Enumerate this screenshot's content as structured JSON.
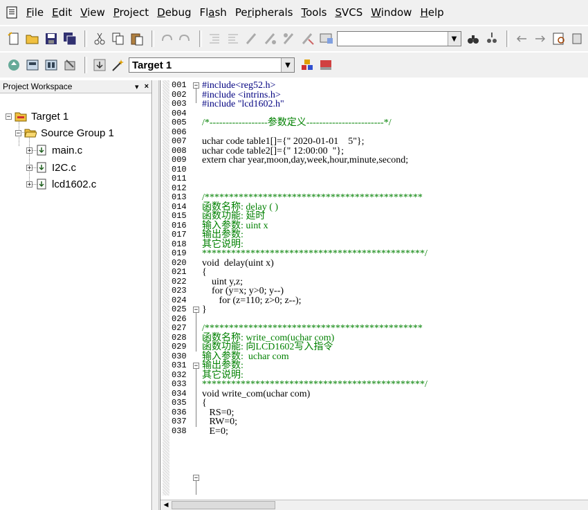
{
  "menu": [
    {
      "acc": "F",
      "rest": "ile",
      "name": "menu-file"
    },
    {
      "acc": "E",
      "rest": "dit",
      "name": "menu-edit"
    },
    {
      "acc": "V",
      "rest": "iew",
      "name": "menu-view"
    },
    {
      "acc": "P",
      "rest": "roject",
      "name": "menu-project"
    },
    {
      "acc": "D",
      "rest": "ebug",
      "name": "menu-debug"
    },
    {
      "pre": "Fl",
      "acc": "a",
      "rest": "sh",
      "name": "menu-flash"
    },
    {
      "pre": "Pe",
      "acc": "r",
      "rest": "ipherals",
      "name": "menu-peripherals"
    },
    {
      "acc": "T",
      "rest": "ools",
      "name": "menu-tools"
    },
    {
      "acc": "S",
      "rest": "VCS",
      "name": "menu-svcs"
    },
    {
      "acc": "W",
      "rest": "indow",
      "name": "menu-window"
    },
    {
      "acc": "H",
      "rest": "elp",
      "name": "menu-help"
    }
  ],
  "toolbar": {
    "find_value": "",
    "target_combo": "Target 1"
  },
  "workspace": {
    "title": "Project Workspace",
    "pin": "▾",
    "close": "×",
    "target": "Target 1",
    "group": "Source Group 1",
    "files": [
      "main.c",
      "I2C.c",
      "lcd1602.c"
    ]
  },
  "editor": {
    "line_numbers": [
      "001",
      "002",
      "003",
      "004",
      "005",
      "006",
      "007",
      "008",
      "009",
      "010",
      "011",
      "012",
      "013",
      "014",
      "015",
      "016",
      "017",
      "018",
      "019",
      "020",
      "021",
      "022",
      "023",
      "024",
      "025",
      "026",
      "027",
      "028",
      "029",
      "030",
      "031",
      "032",
      "033",
      "034",
      "035",
      "036",
      "037",
      "038"
    ],
    "lines": [
      "#include<reg52.h>",
      "#include <intrins.h>",
      "#include \"lcd1602.h\"",
      "",
      "/*------------------参数定义------------------------*/",
      "",
      "uchar code table1[]={\" 2020-01-01    5\"};",
      "uchar code table2[]={\" 12:00:00  \"};",
      "extern char year,moon,day,week,hour,minute,second;",
      "",
      "",
      "",
      "/*********************************************",
      "函数名称: delay ( )",
      "函数功能: 延时",
      "输入参数: uint x",
      "输出参数:",
      "其它说明:",
      "**********************************************/",
      "void  delay(uint x)",
      "{",
      "    uint y,z;",
      "    for (y=x; y>0; y--)",
      "       for (z=110; z>0; z--);",
      "}",
      "",
      "/*********************************************",
      "函数名称: write_com(uchar com)",
      "函数功能: 向LCD1602写入指令",
      "输入参数:  uchar com",
      "输出参数:",
      "其它说明:",
      "**********************************************/",
      "void write_com(uchar com)",
      "{",
      "   RS=0;",
      "   RW=0;",
      "   E=0;"
    ]
  },
  "colors": {
    "preprocessor": "#000080",
    "string": "#800080",
    "comment": "#008000",
    "number": "#ff0000"
  }
}
